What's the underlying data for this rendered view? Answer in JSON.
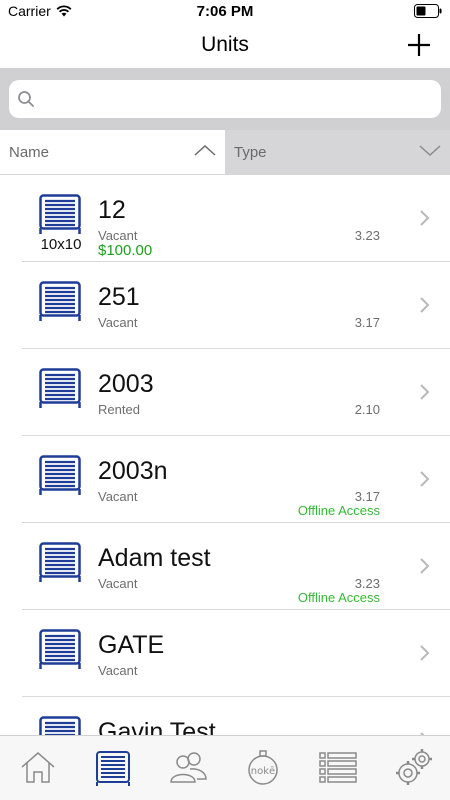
{
  "status_bar": {
    "carrier": "Carrier",
    "time": "7:06 PM"
  },
  "nav": {
    "title": "Units"
  },
  "search": {
    "placeholder": "",
    "value": ""
  },
  "sort": {
    "name_label": "Name",
    "type_label": "Type"
  },
  "colors": {
    "accent": "#1f3c96",
    "green_price": "#1e9e1e",
    "green_offline": "#38b838",
    "search_band": "#d0d0d2"
  },
  "units": [
    {
      "name": "12",
      "status": "Vacant",
      "version": "3.23",
      "size": "10x10",
      "price": "$100.00",
      "offline": ""
    },
    {
      "name": "251",
      "status": "Vacant",
      "version": "3.17",
      "size": "",
      "price": "",
      "offline": ""
    },
    {
      "name": "2003",
      "status": "Rented",
      "version": "2.10",
      "size": "",
      "price": "",
      "offline": ""
    },
    {
      "name": "2003n",
      "status": "Vacant",
      "version": "3.17",
      "size": "",
      "price": "",
      "offline": "Offline Access"
    },
    {
      "name": "Adam test",
      "status": "Vacant",
      "version": "3.23",
      "size": "",
      "price": "",
      "offline": "Offline Access"
    },
    {
      "name": "GATE",
      "status": "Vacant",
      "version": "",
      "size": "",
      "price": "",
      "offline": ""
    },
    {
      "name": "Gavin Test",
      "status": "",
      "version": "",
      "size": "",
      "price": "",
      "offline": ""
    }
  ],
  "tabs": [
    {
      "icon": "home-icon",
      "active": false
    },
    {
      "icon": "unit-icon",
      "active": true
    },
    {
      "icon": "users-icon",
      "active": false
    },
    {
      "icon": "noke-icon",
      "active": false,
      "text": "nokē"
    },
    {
      "icon": "list-icon",
      "active": false
    },
    {
      "icon": "settings-icon",
      "active": false
    }
  ]
}
